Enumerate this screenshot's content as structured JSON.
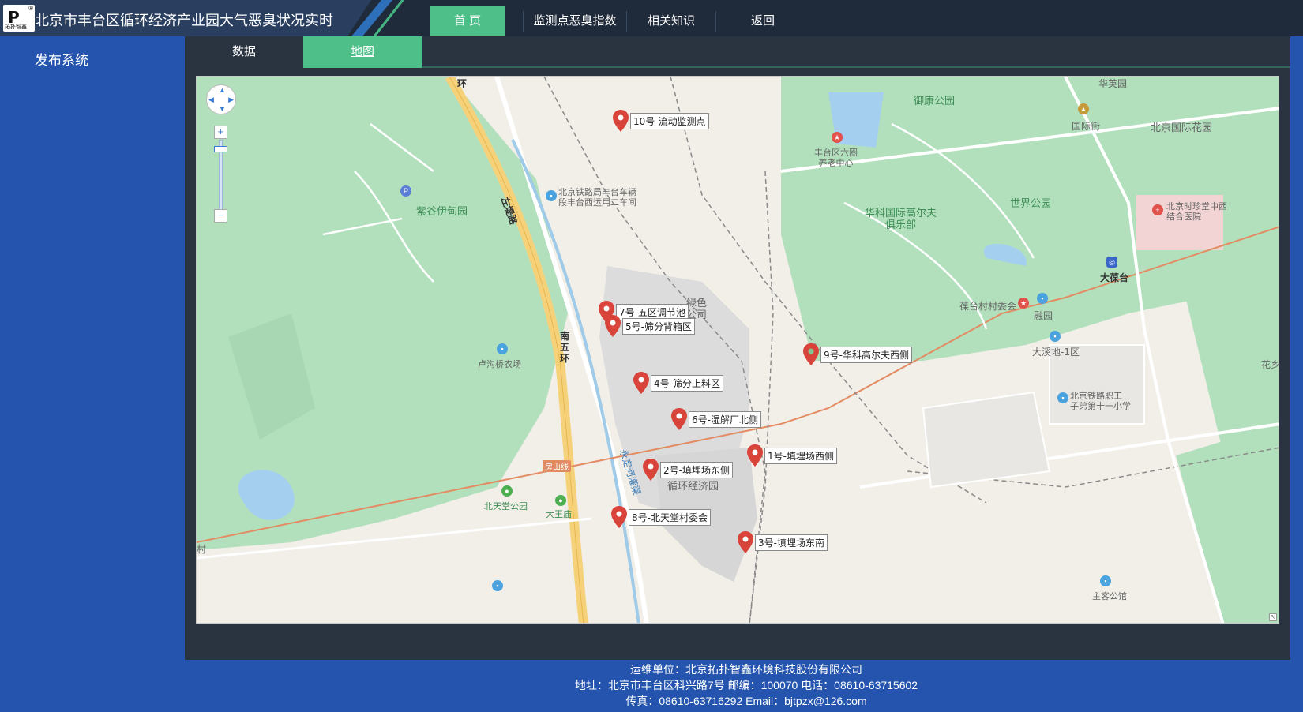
{
  "header": {
    "logo_caption": "拓扑智鑫",
    "logo_mark": "P",
    "title": "北京市丰台区循环经济产业园大气恶臭状况实时",
    "nav": [
      {
        "label": "首 页",
        "active": true
      },
      {
        "label": "监测点恶臭指数",
        "active": false
      },
      {
        "label": "相关知识",
        "active": false
      },
      {
        "label": "返回",
        "active": false
      }
    ]
  },
  "sidebar": {
    "title": "发布系统"
  },
  "tabs": [
    {
      "label": "数据",
      "active": false
    },
    {
      "label": "地图",
      "active": true
    }
  ],
  "map": {
    "zoom_controls": {
      "zoom_in": "+",
      "zoom_out": "−"
    },
    "markers": [
      {
        "label": "10号-流动监测点"
      },
      {
        "label": "7号-五区调节池"
      },
      {
        "label": "5号-筛分背箱区"
      },
      {
        "label": "9号-华科高尔夫西侧"
      },
      {
        "label": "4号-筛分上料区"
      },
      {
        "label": "6号-湿解厂北侧"
      },
      {
        "label": "1号-填埋场西侧"
      },
      {
        "label": "2号-填埋场东侧"
      },
      {
        "label": "8号-北天堂村委会"
      },
      {
        "label": "3号-填埋场东南"
      }
    ],
    "places": {
      "huaying": "华英园",
      "yukang": "御康公园",
      "guojijie": "国际街",
      "guojihuayuan": "北京国际花园",
      "fengtai_yiyuan": "丰台区六圈\n养老中心",
      "shijie": "世界公园",
      "huake": "华科国际高尔夫\n俱乐部",
      "shizhentang": "北京时珍堂中西\n结合医院",
      "dabaotai": "大葆台",
      "baotaicun": "葆台村村委会",
      "rongyuan": "融园",
      "daxidi": "大溪地-1区",
      "tielu_school": "北京铁路职工\n子弟第十一小学",
      "huaxiang": "花乡",
      "tieluju": "北京铁路局丰台车辆\n段丰台西运用二车间",
      "ziguyidian": "紫谷伊甸园",
      "zuodi": "左堤路",
      "nanwuhuan": "南五环",
      "lugouqiao": "卢沟桥农场",
      "fangshan": "房山线",
      "yongding": "永定河灌渠",
      "beitiantang": "北天堂公园",
      "dawangmiao": "大王庙",
      "xunhuan": "循环经济园",
      "green_park": "绿色\n公司",
      "cun": "村",
      "huan": "环",
      "zhuke": "主客公馆"
    }
  },
  "footer": {
    "line1": "运维单位：北京拓扑智鑫环境科技股份有限公司",
    "line2": "地址：北京市丰台区科兴路7号  邮编：100070  电话：08610-63715602",
    "line3": "传真：08610-63716292  Email：bjtpzx@126.com"
  },
  "colors": {
    "page_bg": "#2454ad",
    "header_bg": "#1f2a3a",
    "accent_green": "#4fbf8a",
    "marker_red": "#d9443a"
  }
}
